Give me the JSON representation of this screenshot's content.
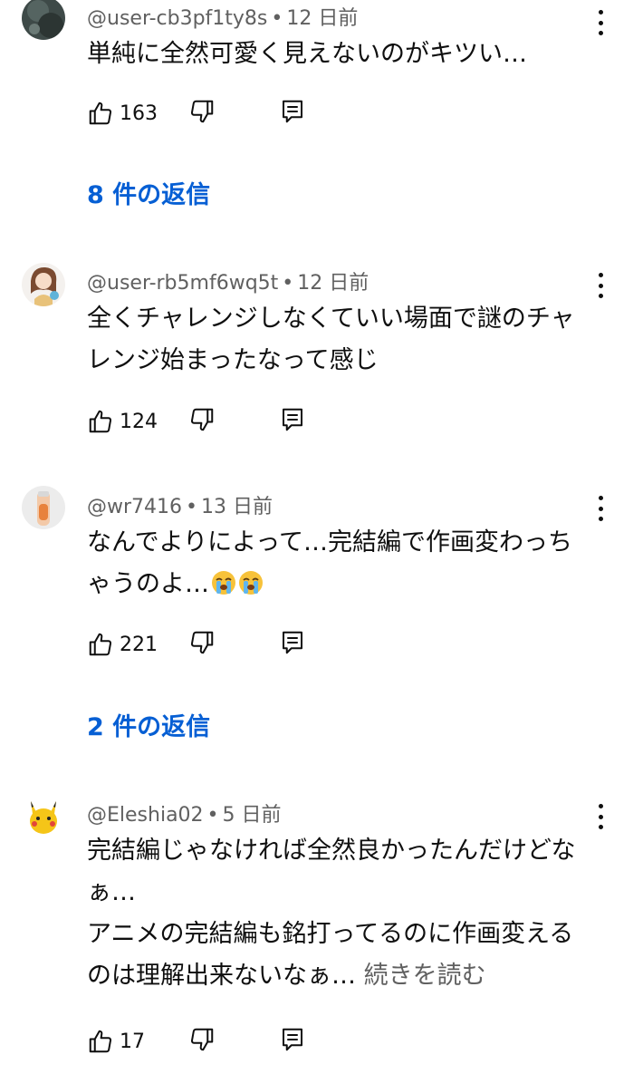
{
  "comments": [
    {
      "handle": "@user-cb3pf1ty8s",
      "dot": "•",
      "time": "12 日前",
      "lines": [
        "単純に全然可愛く見えないのがキツい…"
      ],
      "likes": "163",
      "replies": "8 件の返信"
    },
    {
      "handle": "@user-rb5mf6wq5t",
      "dot": "•",
      "time": "12 日前",
      "lines": [
        "全くチャレンジしなくていい場面で謎のチャ",
        "レンジ始まったなって感じ"
      ],
      "likes": "124"
    },
    {
      "handle": "@wr7416",
      "dot": "•",
      "time": "13 日前",
      "lines": [
        "なんでよりによって…完結編で作画変わっち",
        "ゃうのよ…"
      ],
      "likes": "221",
      "replies": "2 件の返信"
    },
    {
      "handle": "@Eleshia02",
      "dot": "•",
      "time": "5 日前",
      "lines": [
        "完結編じゃなければ全然良かったんだけどな",
        "ぁ…",
        "アニメの完結編も銘打ってるのに作画変える",
        "のは理解出来ないなぁ…"
      ],
      "more": "続きを読む",
      "likes": "17"
    }
  ],
  "icons": {
    "like": "thumbs-up-icon",
    "dislike": "thumbs-down-icon",
    "reply": "reply-comment-icon",
    "menu": "more-vert-icon",
    "emoji": "loudly-crying-face-emoji"
  },
  "colors": {
    "replies_link": "#065fd4",
    "meta": "#606060",
    "text": "#0f0f0f"
  }
}
